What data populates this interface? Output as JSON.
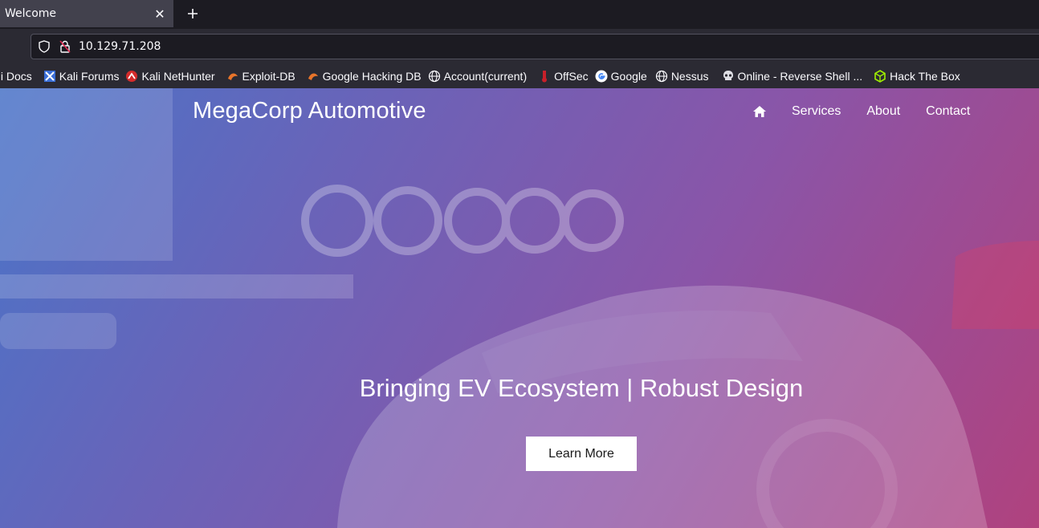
{
  "browser": {
    "tab": {
      "title": "Welcome",
      "close_icon": "close-icon"
    },
    "new_tab_icon": "plus-icon",
    "url": "10.129.71.208",
    "bookmarks": [
      {
        "label": "ali Docs",
        "icon": "kali-docs-icon"
      },
      {
        "label": "Kali Forums",
        "icon": "kali-forums-icon"
      },
      {
        "label": "Kali NetHunter",
        "icon": "kali-nethunter-icon"
      },
      {
        "label": "Exploit-DB",
        "icon": "exploit-db-icon"
      },
      {
        "label": "Google Hacking DB",
        "icon": "ghdb-icon"
      },
      {
        "label": "Account(current)",
        "icon": "globe-icon"
      },
      {
        "label": "OffSec",
        "icon": "offsec-icon"
      },
      {
        "label": "Google",
        "icon": "google-icon"
      },
      {
        "label": "Nessus",
        "icon": "globe-icon"
      },
      {
        "label": "Online - Reverse Shell ...",
        "icon": "skull-icon"
      },
      {
        "label": "Hack The Box",
        "icon": "htb-cube-icon"
      }
    ]
  },
  "site": {
    "brand": "MegaCorp Automotive",
    "nav": {
      "home_icon": "home-icon",
      "links": [
        "Services",
        "About",
        "Contact"
      ]
    },
    "hero": {
      "title": "Bringing EV Ecosystem | Robust Design",
      "button": "Learn More"
    },
    "colors": {
      "gradient_start": "#4a74c8",
      "gradient_mid": "#8a55a8",
      "gradient_end": "#b0427e"
    }
  }
}
